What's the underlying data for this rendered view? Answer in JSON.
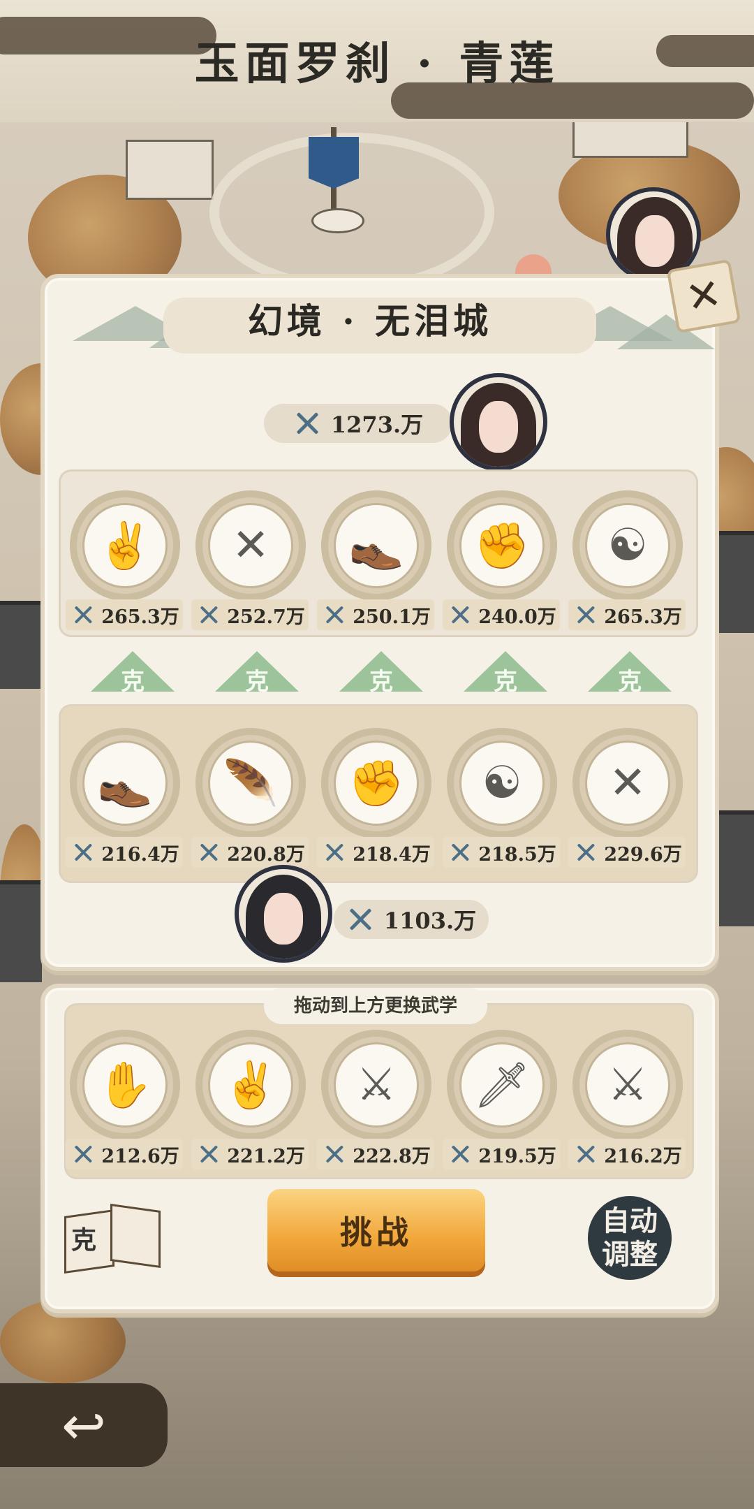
{
  "title": "玉面罗刹 · 青莲",
  "panel_title": "幻境 · 无泪城",
  "enemy": {
    "total_power": "1273.万"
  },
  "player": {
    "total_power": "1103.万"
  },
  "enemy_row": [
    {
      "icon": "two-finger-hand-icon",
      "glyph": "✌",
      "power": "265.3万"
    },
    {
      "icon": "crossed-spears-icon",
      "glyph": "✕",
      "power": "252.7万"
    },
    {
      "icon": "shoe-icon",
      "glyph": "👞",
      "power": "250.1万"
    },
    {
      "icon": "fist-icon",
      "glyph": "✊",
      "power": "240.0万"
    },
    {
      "icon": "meditating-figure-icon",
      "glyph": "☯",
      "power": "265.3万"
    }
  ],
  "counter_label": "克",
  "player_row": [
    {
      "icon": "shoe-icon",
      "glyph": "👞",
      "power": "216.4万"
    },
    {
      "icon": "feather-icon",
      "glyph": "🪶",
      "power": "220.8万"
    },
    {
      "icon": "fist-icon",
      "glyph": "✊",
      "power": "218.4万"
    },
    {
      "icon": "meditating-figure-icon",
      "glyph": "☯",
      "power": "218.5万"
    },
    {
      "icon": "crossed-spears-icon",
      "glyph": "✕",
      "power": "229.6万"
    }
  ],
  "bench_label": "拖动到上方更换武学",
  "bench_row": [
    {
      "icon": "open-palm-icon",
      "glyph": "✋",
      "power": "212.6万"
    },
    {
      "icon": "two-finger-hand-icon",
      "glyph": "✌",
      "power": "221.2万"
    },
    {
      "icon": "saber-icon",
      "glyph": "⚔",
      "power": "222.8万"
    },
    {
      "icon": "sword-icon",
      "glyph": "🗡",
      "power": "219.5万"
    },
    {
      "icon": "throwing-knives-icon",
      "glyph": "⚔",
      "power": "216.2万"
    }
  ],
  "buttons": {
    "challenge": "挑战",
    "auto_line1": "自动",
    "auto_line2": "调整",
    "book_char": "克",
    "close": "✕",
    "back": "↩"
  },
  "colors": {
    "accent": "#f1a73b",
    "counter_green": "#9cc39a",
    "power_icon": "#4d6f86"
  }
}
